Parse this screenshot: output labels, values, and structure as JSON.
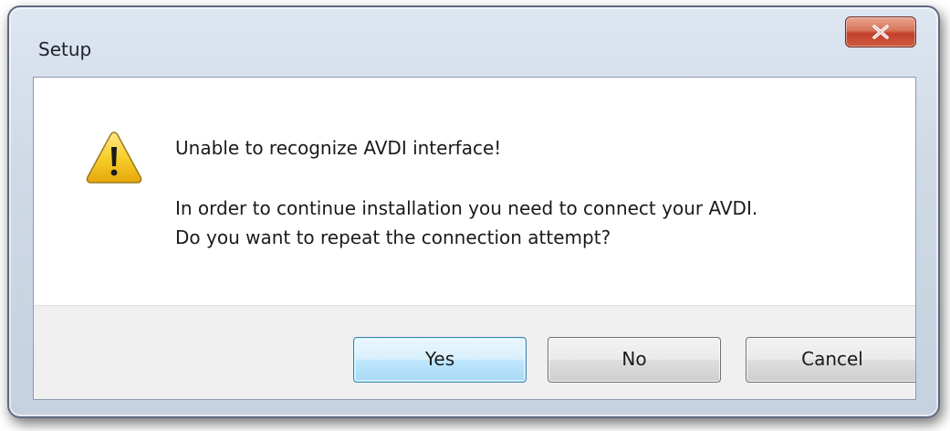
{
  "window": {
    "title": "Setup"
  },
  "dialog": {
    "icon": "warning-icon",
    "heading": "Unable to recognize AVDI interface!",
    "message_line1": "In order to continue installation you need to connect your AVDI.",
    "message_line2": "Do you want to repeat the connection attempt?"
  },
  "buttons": {
    "yes": "Yes",
    "no": "No",
    "cancel": "Cancel"
  },
  "colors": {
    "close_button": "#c94a33",
    "default_button_border": "#3c7fb1",
    "warning_fill": "#f2c21a"
  }
}
